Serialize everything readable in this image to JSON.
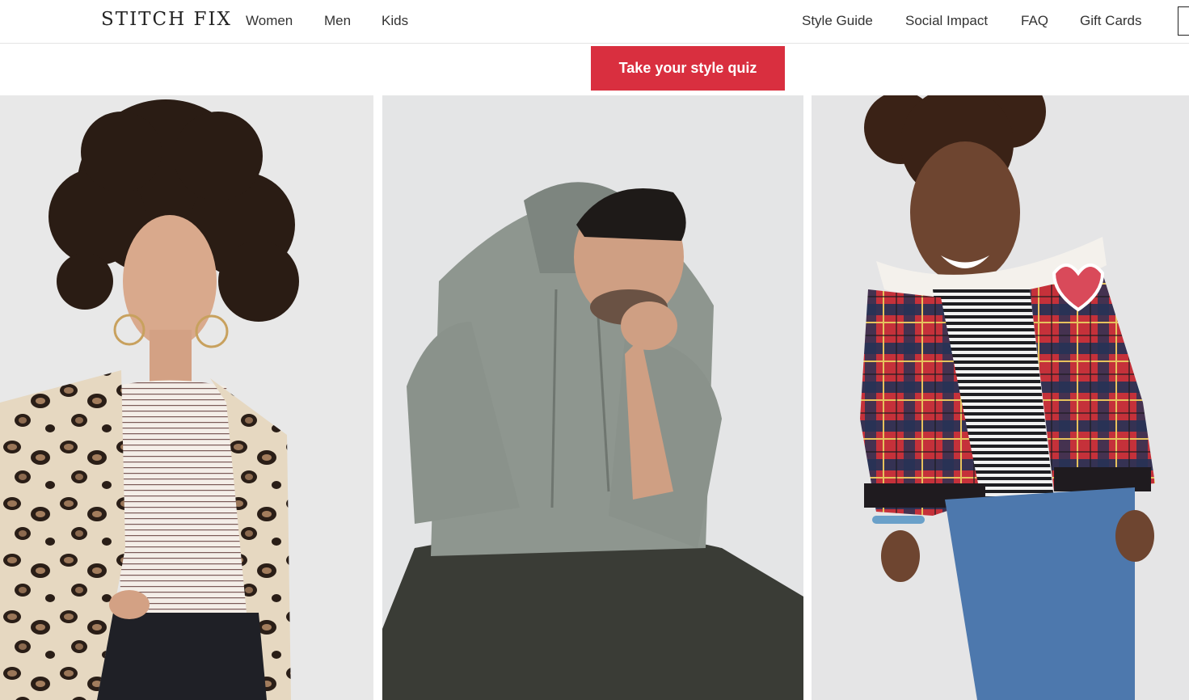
{
  "brand": {
    "logo_text": "STITCH FIX"
  },
  "nav": {
    "primary": [
      {
        "label": "Women"
      },
      {
        "label": "Men"
      },
      {
        "label": "Kids"
      }
    ],
    "secondary": [
      {
        "label": "Style Guide"
      },
      {
        "label": "Social Impact"
      },
      {
        "label": "FAQ"
      },
      {
        "label": "Gift Cards"
      }
    ]
  },
  "cta": {
    "label": "Take your style quiz"
  },
  "hero": {
    "tiles": [
      {
        "category": "women",
        "description_icon": "model-woman-leopard-cardigan"
      },
      {
        "category": "men",
        "description_icon": "model-man-gray-hoodie"
      },
      {
        "category": "kids",
        "description_icon": "model-kid-plaid-jacket"
      }
    ]
  },
  "colors": {
    "accent": "#d92f3f",
    "text": "#333333",
    "logo": "#222222",
    "tile_background": "#e9e9ea"
  }
}
